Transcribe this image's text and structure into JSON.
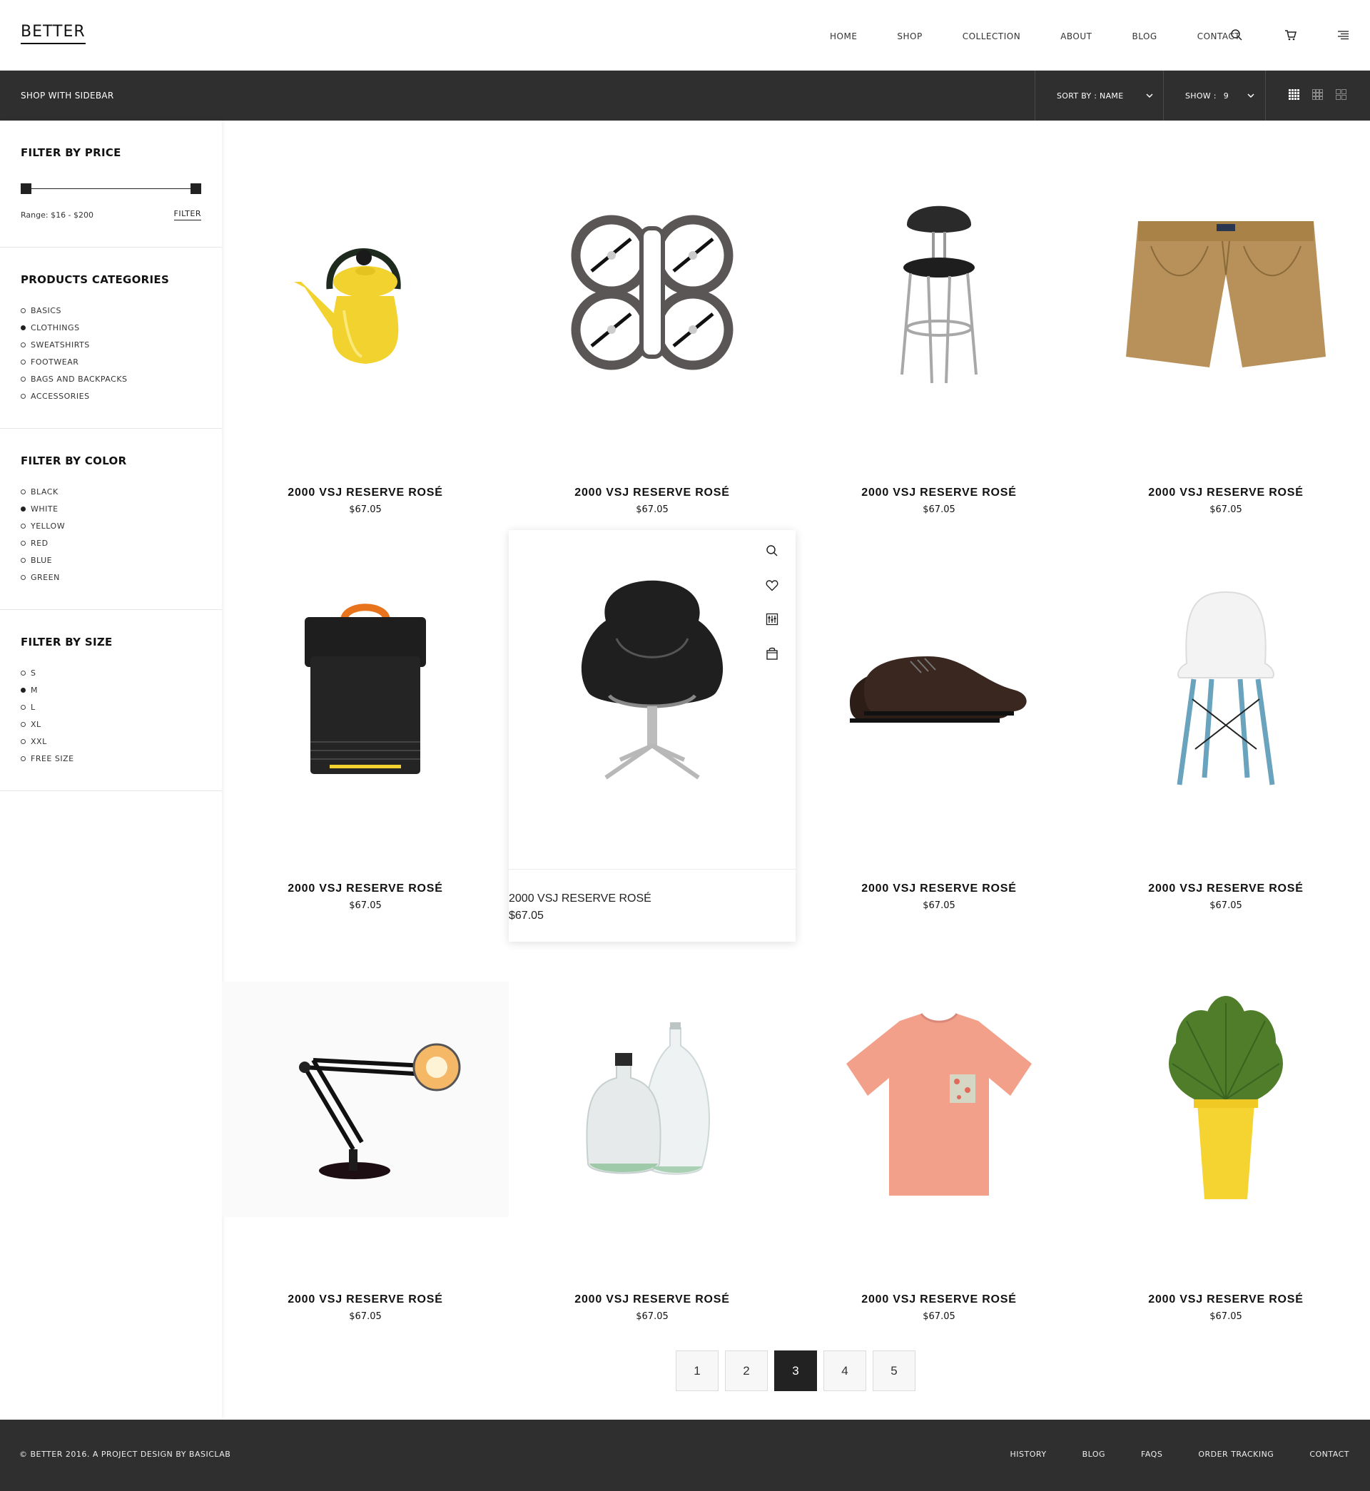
{
  "header": {
    "logo": "BETTER",
    "nav": [
      "HOME",
      "SHOP",
      "COLLECTION",
      "ABOUT",
      "BLOG",
      "CONTACT"
    ],
    "icons": [
      "search-icon",
      "cart-icon",
      "menu-icon"
    ]
  },
  "toolbar": {
    "title": "SHOP WITH SIDEBAR",
    "sort_label": "SORT BY : NAME",
    "show_label": "SHOW :",
    "show_value": "9",
    "view_icons": [
      "grid-4-icon",
      "grid-3-icon",
      "grid-2-icon"
    ]
  },
  "sidebar": {
    "price": {
      "title": "FILTER BY PRICE",
      "range": "Range: $16 - $200",
      "filter_label": "FILTER"
    },
    "categories": {
      "title": "PRODUCTS CATEGORIES",
      "items": [
        "BASICS",
        "CLOTHINGS",
        "SWEATSHIRTS",
        "FOOTWEAR",
        "BAGS AND BACKPACKS",
        "ACCESSORIES"
      ],
      "selected": 1
    },
    "color": {
      "title": "FILTER BY COLOR",
      "items": [
        "BLACK",
        "WHITE",
        "YELLOW",
        "RED",
        "BLUE",
        "GREEN"
      ],
      "selected": 1
    },
    "size": {
      "title": "FILTER BY SIZE",
      "items": [
        "S",
        "M",
        "L",
        "XL",
        "XXL",
        "FREE SIZE"
      ],
      "selected": 1
    }
  },
  "products": [
    {
      "name": "2000 VSJ RESERVE ROSÉ",
      "price": "$67.05",
      "image": "yellow-kettle"
    },
    {
      "name": "2000 VSJ RESERVE ROSÉ",
      "price": "$67.05",
      "image": "quadcopter-drone"
    },
    {
      "name": "2000 VSJ RESERVE ROSÉ",
      "price": "$67.05",
      "image": "bar-stool"
    },
    {
      "name": "2000 VSJ RESERVE ROSÉ",
      "price": "$67.05",
      "image": "khaki-shorts"
    },
    {
      "name": "2000 VSJ RESERVE ROSÉ",
      "price": "$67.05",
      "image": "black-backpack"
    },
    {
      "name": "2000 VSJ RESERVE ROSÉ",
      "price": "$67.05",
      "image": "black-swan-chair"
    },
    {
      "name": "2000 VSJ RESERVE ROSÉ",
      "price": "$67.05",
      "image": "leather-shoes"
    },
    {
      "name": "2000 VSJ RESERVE ROSÉ",
      "price": "$67.05",
      "image": "white-eiffel-chair"
    },
    {
      "name": "2000 VSJ RESERVE ROSÉ",
      "price": "$67.05",
      "image": "desk-lamp"
    },
    {
      "name": "2000 VSJ RESERVE ROSÉ",
      "price": "$67.05",
      "image": "glass-bottles"
    },
    {
      "name": "2000 VSJ RESERVE ROSÉ",
      "price": "$67.05",
      "image": "pink-tshirt"
    },
    {
      "name": "2000 VSJ RESERVE ROSÉ",
      "price": "$67.05",
      "image": "potted-plant"
    }
  ],
  "hover_actions": [
    "zoom-icon",
    "heart-icon",
    "compare-icon",
    "cart-add-icon"
  ],
  "pagination": {
    "pages": [
      "1",
      "2",
      "3",
      "4",
      "5"
    ],
    "current": "3"
  },
  "footer": {
    "copyright": "© BETTER 2016. A PROJECT DESIGN BY BASICLAB",
    "links": [
      "HISTORY",
      "BLOG",
      "FAQS",
      "ORDER TRACKING",
      "CONTACT"
    ]
  },
  "colors": {
    "dark_bar": "#2f2f2f",
    "accent_yellow": "#f2d22e"
  }
}
